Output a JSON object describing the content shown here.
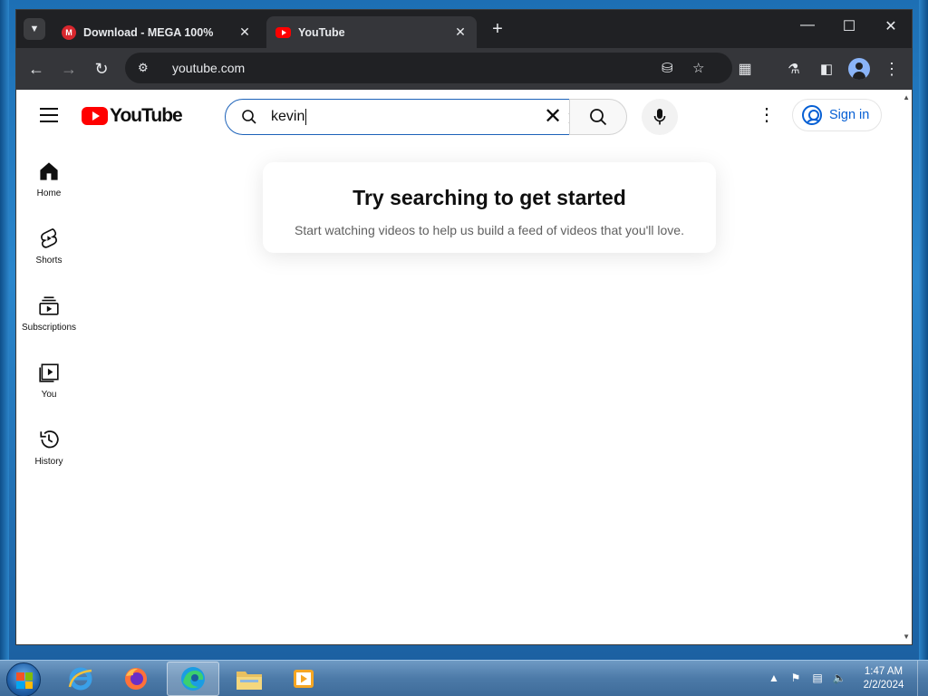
{
  "browser": {
    "tabs": [
      {
        "title": "Download - MEGA 100%",
        "favicon": "mega-icon",
        "active": false
      },
      {
        "title": "YouTube",
        "favicon": "youtube-icon",
        "active": true
      }
    ],
    "url": "youtube.com",
    "colors": {
      "frame": "#202124",
      "toolbar": "#35363a"
    }
  },
  "youtube": {
    "logo_text": "YouTube",
    "search": {
      "query": "kevin"
    },
    "signin_label": "Sign in",
    "guide": [
      {
        "label": "Home",
        "icon": "home-icon"
      },
      {
        "label": "Shorts",
        "icon": "shorts-icon"
      },
      {
        "label": "Subscriptions",
        "icon": "subscriptions-icon"
      },
      {
        "label": "You",
        "icon": "you-icon"
      },
      {
        "label": "History",
        "icon": "history-icon"
      }
    ],
    "prompt": {
      "heading": "Try searching to get started",
      "body": "Start watching videos to help us build a feed of videos that you'll love."
    },
    "colors": {
      "brand_red": "#ff0000",
      "link_blue": "#065fd4",
      "search_border": "#1c62b9"
    }
  },
  "taskbar": {
    "apps": [
      "internet-explorer-icon",
      "firefox-icon",
      "edge-icon",
      "file-explorer-icon",
      "media-player-icon"
    ],
    "clock": {
      "time": "1:47 AM",
      "date": "2/2/2024"
    }
  }
}
